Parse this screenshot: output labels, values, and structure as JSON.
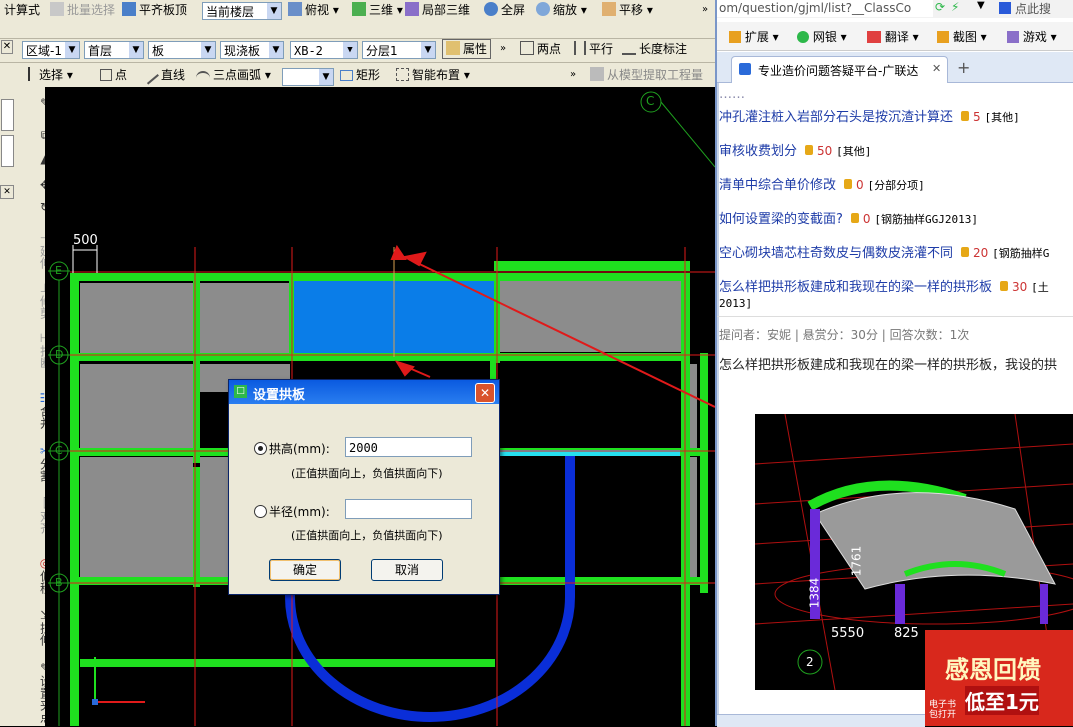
{
  "cad": {
    "toolbar1": {
      "calc_label": "计算式",
      "batch_select_label": "批量选择",
      "flush_board_label": "平齐板顶",
      "floor_select": "当前楼层",
      "view_label": "俯视",
      "three_d_label": "三维",
      "partial_3d_label": "局部三维",
      "fullscreen_label": "全屏",
      "zoom_label": "缩放",
      "pan_label": "平移"
    },
    "toolbar2": {
      "region_select": "区域-1",
      "floor_select": "首层",
      "category_select": "板",
      "type_select": "现浇板",
      "name_select": "XB-2",
      "layer_select": "分层1",
      "properties_label": "属性",
      "two_points_label": "两点",
      "parallel_label": "平行",
      "length_label_label": "长度标注"
    },
    "toolbar3": {
      "select_label": "选择",
      "point_label": "点",
      "line_label": "直线",
      "arc_label": "三点画弧",
      "rect_label": "矩形",
      "smart_layout_label": "智能布置",
      "extract_label": "从模型提取工程量"
    },
    "side_tools": [
      "延伸",
      "修剪",
      "打断",
      "合并",
      "分割",
      "对齐",
      "偏移",
      "拉伸",
      "设置夹点"
    ],
    "dimension_label": "500",
    "axis_labels": [
      "E",
      "D",
      "C",
      "B"
    ],
    "top_axis_label": "C",
    "dialog": {
      "title": "设置拱板",
      "arch_height_label": "拱高(mm):",
      "arch_height_value": "2000",
      "arch_height_hint": "(正值拱面向上，负值拱面向下)",
      "radius_label": "半径(mm):",
      "radius_value": "",
      "radius_hint": "(正值拱面向上，负值拱面向下)",
      "ok_label": "确定",
      "cancel_label": "取消",
      "close_symbol": "✕"
    }
  },
  "browser": {
    "address": "om/question/gjml/list?__ClassCo",
    "search_hint": "点此搜",
    "toolbar": {
      "extensions_label": "扩展",
      "netbank_label": "网银",
      "translate_label": "翻译",
      "screenshot_label": "截图",
      "games_label": "游戏"
    },
    "tab_title": "专业造价问题答疑平台-广联达",
    "tab_close": "✕",
    "new_tab": "+",
    "questions": [
      {
        "title": "冲孔灌注桩入岩部分石头是按沉渣计算还",
        "reward": "5",
        "category": "[其他]"
      },
      {
        "title": "审核收费划分",
        "reward": "50",
        "category": "[其他]"
      },
      {
        "title": "清单中综合单价修改",
        "reward": "0",
        "category": "[分部分项]"
      },
      {
        "title": "如何设置梁的变截面?",
        "reward": "0",
        "category": "[钢筋抽样GGJ2013]"
      },
      {
        "title": "空心砌块墙芯柱奇数皮与偶数皮浇灌不同",
        "reward": "20",
        "category": "[钢筋抽样G"
      },
      {
        "title": "怎么样把拱形板建成和我现在的梁一样的拱形板",
        "reward": "30",
        "category": "[土"
      }
    ],
    "question_tail": "2013]",
    "meta": "提问者：安妮   |   悬赏分：30分   |   回答次数：1次",
    "meta_asker": "安妮",
    "question_body": "怎么样把拱形板建成和我现在的梁一样的拱形板，我设的拱",
    "image_labels": {
      "dim1": "1384",
      "dim2": "1761",
      "dim3": "5550",
      "dim4": "825",
      "axis": "2"
    },
    "ad_text": "感恩回馈",
    "ad_subtext": "低至1元",
    "ad_badge": "电子书 包打开"
  },
  "colors": {
    "green": "#1fe01f",
    "blue": "#0a7de8",
    "gray": "#8c8c8c",
    "red": "#e01a1a",
    "cyan": "#26e0f0"
  }
}
